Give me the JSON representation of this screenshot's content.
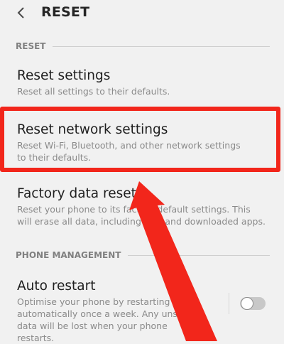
{
  "header": {
    "title": "RESET"
  },
  "sections": {
    "reset_label": "RESET",
    "phone_management_label": "PHONE MANAGEMENT"
  },
  "items": {
    "reset_settings": {
      "title": "Reset settings",
      "subtitle": "Reset all settings to their defaults."
    },
    "reset_network": {
      "title": "Reset network settings",
      "subtitle": "Reset Wi-Fi, Bluetooth, and other network settings to their defaults."
    },
    "factory_reset": {
      "title": "Factory data reset",
      "subtitle": "Reset your phone to its factory default settings. This will erase all data, including files and downloaded apps."
    },
    "auto_restart": {
      "title": "Auto restart",
      "subtitle": "Optimise your phone by restarting it automatically once a week. Any unsaved data will be lost when your phone restarts.",
      "enabled": false
    }
  },
  "colors": {
    "annotation_red": "#f2261b",
    "background": "#f1f1f1"
  },
  "icons": {
    "back": "back-arrow-icon"
  }
}
